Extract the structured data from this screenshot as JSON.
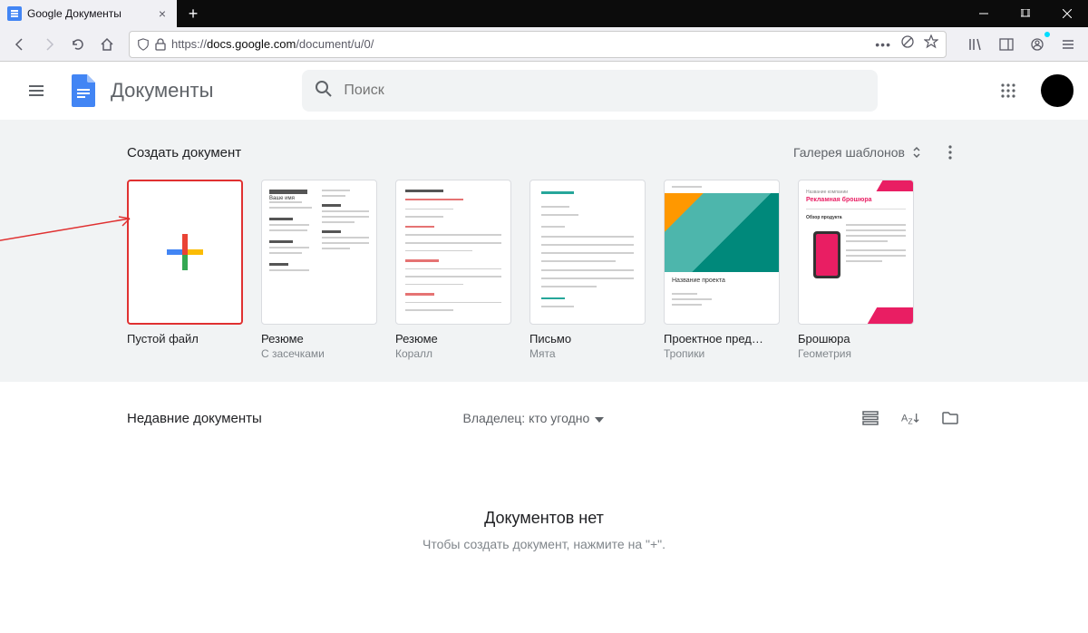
{
  "browser": {
    "tab_title": "Google Документы",
    "url_prefix": "https://",
    "url_domain": "docs.google.com",
    "url_path": "/document/u/0/"
  },
  "header": {
    "app_title": "Документы",
    "search_placeholder": "Поиск"
  },
  "templates": {
    "section_title": "Создать документ",
    "gallery_label": "Галерея шаблонов",
    "items": [
      {
        "name": "Пустой файл",
        "sub": ""
      },
      {
        "name": "Резюме",
        "sub": "С засечками"
      },
      {
        "name": "Резюме",
        "sub": "Коралл"
      },
      {
        "name": "Письмо",
        "sub": "Мята"
      },
      {
        "name": "Проектное пред…",
        "sub": "Тропики"
      },
      {
        "name": "Брошюра",
        "sub": "Геометрия"
      }
    ],
    "thumb_text": {
      "resume_name": "Ваше имя",
      "project_name": "Название проекта",
      "brochure_company": "Название компании",
      "brochure_title": "Рекламная брошюра",
      "brochure_sub": "Обзор продукта"
    }
  },
  "recent": {
    "title": "Недавние документы",
    "owner_filter": "Владелец: кто угодно",
    "empty_title": "Документов нет",
    "empty_subtitle": "Чтобы создать документ, нажмите на \"+\"."
  }
}
